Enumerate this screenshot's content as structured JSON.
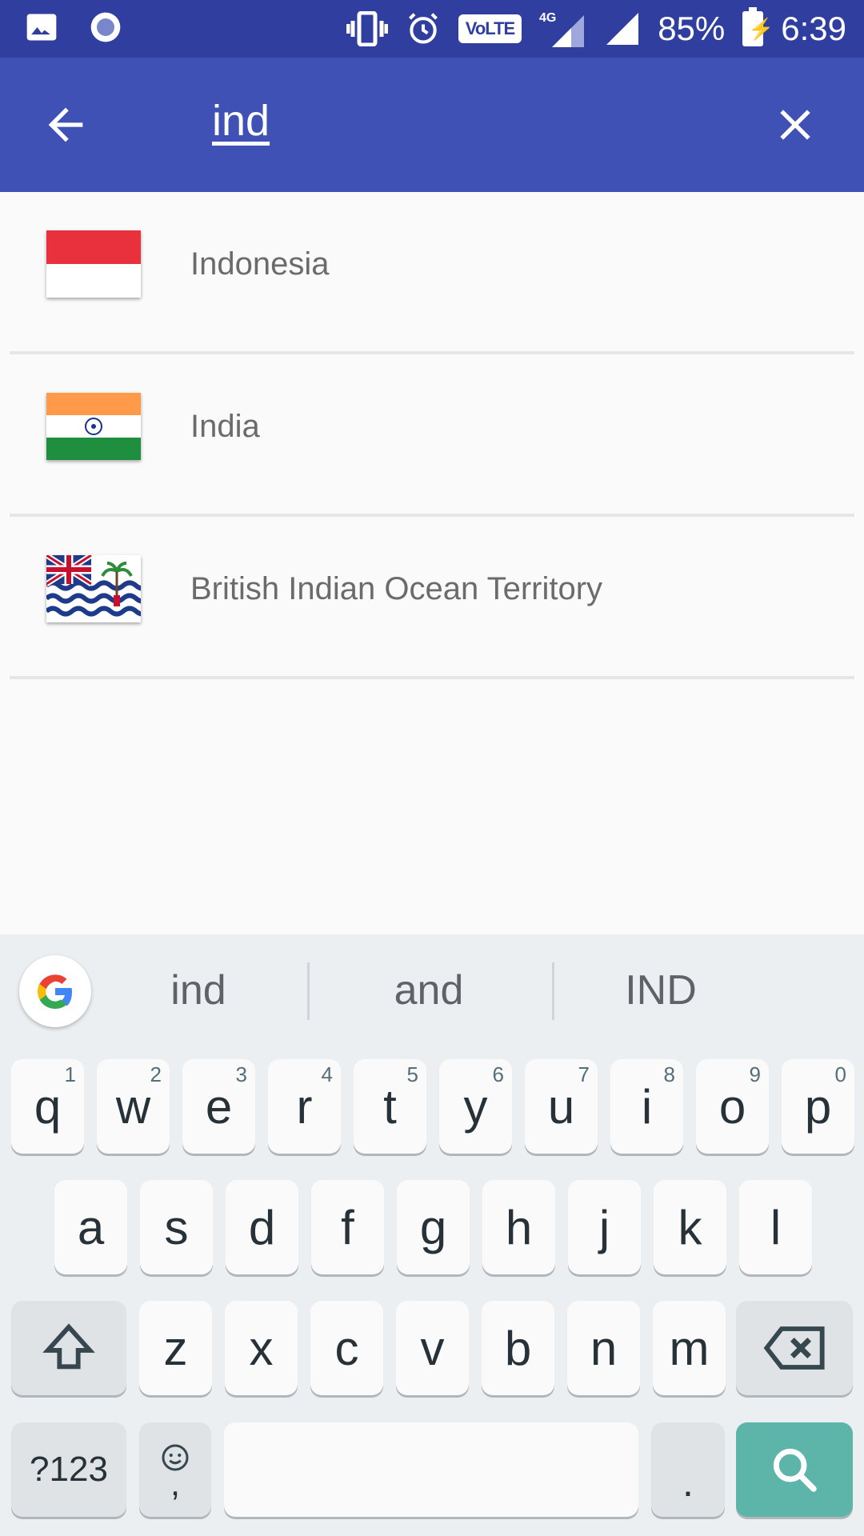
{
  "status_bar": {
    "battery_percent": "85%",
    "time": "6:39",
    "network_label": "4G",
    "volte_label": "VoLTE",
    "icons": [
      "image-icon",
      "circle-app-icon",
      "vibrate-icon",
      "alarm-icon",
      "volte-icon",
      "signal-4g-icon",
      "signal-icon",
      "battery-charging-icon"
    ]
  },
  "toolbar": {
    "search_value": "ind",
    "back_icon": "arrow-back-icon",
    "clear_icon": "close-icon",
    "color": "#3f51b5"
  },
  "results": [
    {
      "name": "Indonesia",
      "flag": "indonesia-flag"
    },
    {
      "name": "India",
      "flag": "india-flag"
    },
    {
      "name": "British Indian Ocean Territory",
      "flag": "biot-flag"
    }
  ],
  "keyboard": {
    "suggestions": [
      "ind",
      "and",
      "IND"
    ],
    "row1": [
      {
        "k": "q",
        "h": "1"
      },
      {
        "k": "w",
        "h": "2"
      },
      {
        "k": "e",
        "h": "3"
      },
      {
        "k": "r",
        "h": "4"
      },
      {
        "k": "t",
        "h": "5"
      },
      {
        "k": "y",
        "h": "6"
      },
      {
        "k": "u",
        "h": "7"
      },
      {
        "k": "i",
        "h": "8"
      },
      {
        "k": "o",
        "h": "9"
      },
      {
        "k": "p",
        "h": "0"
      }
    ],
    "row2": [
      "a",
      "s",
      "d",
      "f",
      "g",
      "h",
      "j",
      "k",
      "l"
    ],
    "row3": [
      "z",
      "x",
      "c",
      "v",
      "b",
      "n",
      "m"
    ],
    "mode_key": "?123",
    "comma_key": ",",
    "period_key": ".",
    "action_color": "#5db5aa"
  }
}
